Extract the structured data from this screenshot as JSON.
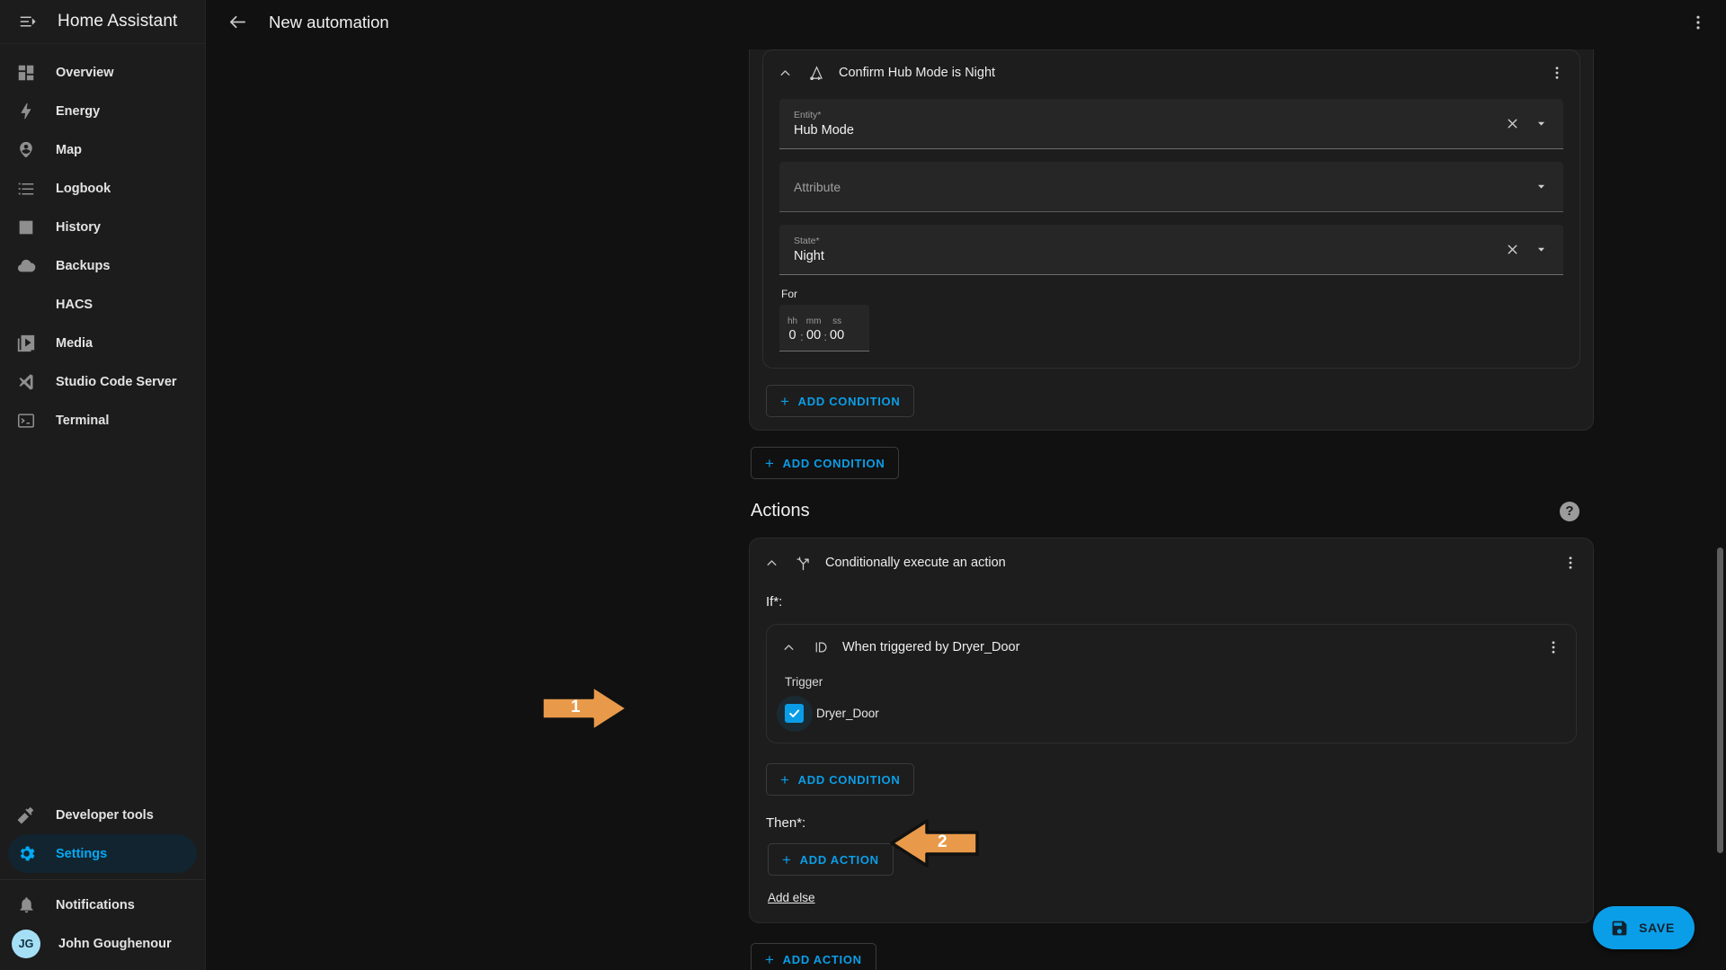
{
  "sidebar": {
    "title": "Home Assistant",
    "menu_icon": "menu-collapse-icon",
    "items": [
      {
        "label": "Overview",
        "icon": "view-dashboard-icon",
        "active": false
      },
      {
        "label": "Energy",
        "icon": "lightning-bolt-icon",
        "active": false
      },
      {
        "label": "Map",
        "icon": "map-marker-account-icon",
        "active": false
      },
      {
        "label": "Logbook",
        "icon": "format-list-bulleted-icon",
        "active": false
      },
      {
        "label": "History",
        "icon": "chart-box-icon",
        "active": false
      },
      {
        "label": "Backups",
        "icon": "cloud-icon",
        "active": false
      },
      {
        "label": "HACS",
        "icon": "none",
        "active": false
      },
      {
        "label": "Media",
        "icon": "play-box-multiple-icon",
        "active": false
      },
      {
        "label": "Studio Code Server",
        "icon": "vscode-icon",
        "active": false
      },
      {
        "label": "Terminal",
        "icon": "console-icon",
        "active": false
      }
    ],
    "bottom_items": [
      {
        "label": "Developer tools",
        "icon": "hammer-icon",
        "active": false
      },
      {
        "label": "Settings",
        "icon": "cog-icon",
        "active": true
      }
    ],
    "notifications": {
      "label": "Notifications",
      "icon": "bell-icon"
    },
    "user": {
      "label": "John Goughenour",
      "initials": "JG"
    }
  },
  "header": {
    "back_icon": "arrow-left-icon",
    "title": "New automation",
    "overflow_icon": "dots-vertical-icon"
  },
  "condition_card": {
    "title": "Confirm Hub Mode is Night",
    "icon": "state-condition-icon",
    "collapse_icon": "chevron-up-icon",
    "overflow_icon": "dots-vertical-icon",
    "fields": {
      "entity": {
        "label": "Entity*",
        "value": "Hub Mode",
        "clear_icon": "close-icon",
        "dropdown_icon": "menu-down-icon"
      },
      "attribute": {
        "label": "Attribute",
        "value": "",
        "dropdown_icon": "menu-down-icon"
      },
      "state": {
        "label": "State*",
        "value": "Night",
        "clear_icon": "close-icon",
        "dropdown_icon": "menu-down-icon"
      }
    },
    "duration": {
      "label": "For",
      "hh_label": "hh",
      "mm_label": "mm",
      "ss_label": "ss",
      "hh": "0",
      "mm": "00",
      "ss": "00",
      "separator": ":"
    },
    "add_condition_label": "ADD CONDITION"
  },
  "outer_add_condition_label": "ADD CONDITION",
  "actions_section": {
    "title": "Actions",
    "help_icon": "help-circle-icon"
  },
  "action_card": {
    "title": "Conditionally execute an action",
    "icon": "call-split-icon",
    "collapse_icon": "chevron-up-icon",
    "overflow_icon": "dots-vertical-icon",
    "if_label": "If*:",
    "then_label": "Then*:",
    "add_else_label": "Add else",
    "add_condition_label": "ADD CONDITION",
    "add_action_label": "ADD ACTION",
    "trigger_card": {
      "title": "When triggered by Dryer_Door",
      "icon": "identifier-icon",
      "collapse_icon": "chevron-up-icon",
      "overflow_icon": "dots-vertical-icon",
      "trigger_label": "Trigger",
      "checkbox": {
        "label": "Dryer_Door",
        "checked": true
      }
    }
  },
  "bottom_add_action_label": "ADD ACTION",
  "save_button": {
    "label": "SAVE",
    "icon": "content-save-icon"
  },
  "annotations": [
    {
      "number": "1",
      "target": "trigger-checkbox"
    },
    {
      "number": "2",
      "target": "then-add-action-button"
    }
  ],
  "colors": {
    "accent": "#0b9ee8",
    "annotation": "#e89a4a",
    "sidebar_bg": "#1c1c1c",
    "page_bg": "#111111",
    "card_bg": "#1d1d1d"
  }
}
